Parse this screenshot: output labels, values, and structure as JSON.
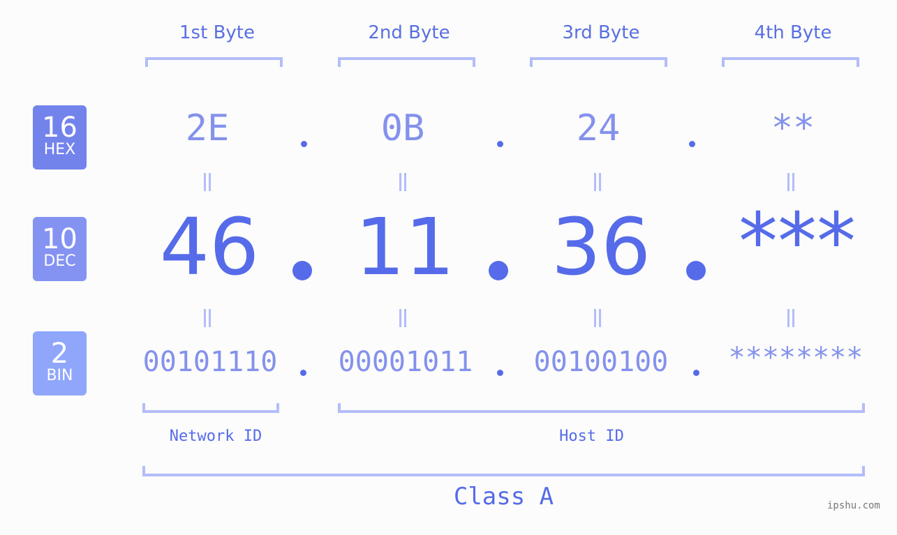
{
  "bytes": {
    "labels": [
      "1st Byte",
      "2nd Byte",
      "3rd Byte",
      "4th Byte"
    ]
  },
  "badges": {
    "hex": {
      "num": "16",
      "label": "HEX",
      "color": "#7383ec"
    },
    "dec": {
      "num": "10",
      "label": "DEC",
      "color": "#8493f2"
    },
    "bin": {
      "num": "2",
      "label": "BIN",
      "color": "#8fa6fb"
    }
  },
  "hex_values": [
    "2E",
    "0B",
    "24",
    "**"
  ],
  "dec_values": [
    "46",
    "11",
    "36",
    "***"
  ],
  "bin_values": [
    "00101110",
    "00001011",
    "00100100",
    "********"
  ],
  "separator": ".",
  "network_id_label": "Network ID",
  "host_id_label": "Host ID",
  "class_label": "Class A",
  "watermark": "ipshu.com",
  "colors": {
    "accent": "#566be9",
    "light_value": "#8491ec",
    "bracket": "#b3bdfa",
    "background": "#fbfcfb"
  }
}
